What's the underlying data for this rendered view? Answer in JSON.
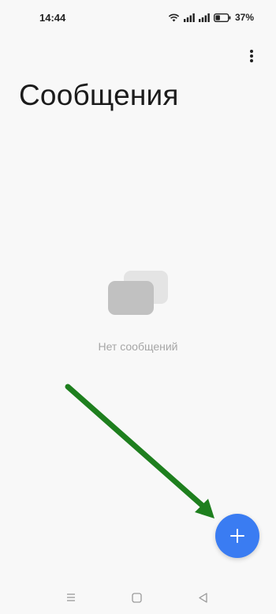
{
  "status_bar": {
    "time": "14:44",
    "battery_percent": "37%",
    "battery_level": 0.37
  },
  "header": {
    "title": "Сообщения"
  },
  "empty_state": {
    "text": "Нет сообщений"
  },
  "fab": {
    "icon": "plus-icon",
    "color": "#3a7cf2"
  },
  "annotation": {
    "arrow_color": "#1e7f1e"
  },
  "nav_bar": {
    "buttons": [
      "menu-icon",
      "home-icon",
      "back-icon"
    ]
  }
}
